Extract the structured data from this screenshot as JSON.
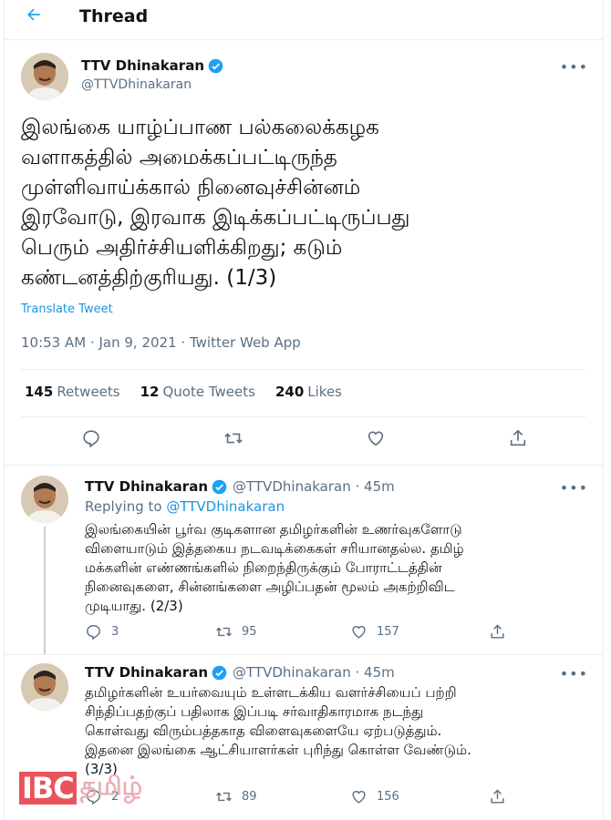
{
  "header": {
    "title": "Thread"
  },
  "main_tweet": {
    "name": "TTV Dhinakaran",
    "handle": "@TTVDhinakaran",
    "more": "•••",
    "text_lines": [
      "இலங்கை யாழ்ப்பாண பல்கலைக்கழக",
      "வளாகத்தில் அமைக்கப்பட்டிருந்த",
      "முள்ளிவாய்க்கால் நினைவுச்சின்னம்",
      "இரவோடு, இரவாக இடிக்கப்பட்டிருப்பது",
      "பெரும் அதிர்ச்சியளிக்கிறது; கடும்",
      "கண்டனத்திற்குரியது. (1/3)"
    ],
    "translate": "Translate Tweet",
    "meta": "10:53 AM · Jan 9, 2021 · Twitter Web App",
    "stats": {
      "retweets_count": "145",
      "retweets_label": "Retweets",
      "quotes_count": "12",
      "quotes_label": "Quote Tweets",
      "likes_count": "240",
      "likes_label": "Likes"
    }
  },
  "replies": [
    {
      "name": "TTV Dhinakaran",
      "handle_time": "@TTVDhinakaran · 45m",
      "replying_prefix": "Replying to",
      "replying_to": "@TTVDhinakaran",
      "text_lines": [
        "இலங்கையின் பூர்வ குடிகளான தமிழர்களின் உணர்வுகளோடு",
        "விளையாடும் இத்தகைய நடவடிக்கைகள் சரியானதல்ல. தமிழ்",
        "மக்களின் எண்ணங்களில் நிறைந்திருக்கும் போராட்டத்தின்",
        "நினைவுகளை, சின்னங்களை அழிப்பதன் மூலம் அகற்றிவிட",
        "முடியாது. (2/3)"
      ],
      "reply_count": "3",
      "retweet_count": "95",
      "like_count": "157"
    },
    {
      "name": "TTV Dhinakaran",
      "handle_time": "@TTVDhinakaran · 45m",
      "text_lines": [
        "தமிழர்களின் உயர்வையும் உள்ளடக்கிய வளர்ச்சியைப் பற்றி",
        "சிந்திப்பதற்குப் பதிலாக இப்படி சர்வாதிகாரமாக நடந்து",
        "கொள்வது விரும்பத்தகாத விளைவுகளையே ஏற்படுத்தும்.",
        "இதனை இலங்கை ஆட்சியாளர்கள் புரிந்து கொள்ள வேண்டும்.",
        "(3/3)"
      ],
      "reply_count": "2",
      "retweet_count": "89",
      "like_count": "156"
    }
  ],
  "watermark": {
    "brand": "IBC",
    "suffix": "தமிழ்"
  },
  "colors": {
    "accent": "#1da1f2",
    "link": "#1b95e0",
    "muted": "#5b7083",
    "text": "#0f1419",
    "watermark": "#e8414b"
  }
}
